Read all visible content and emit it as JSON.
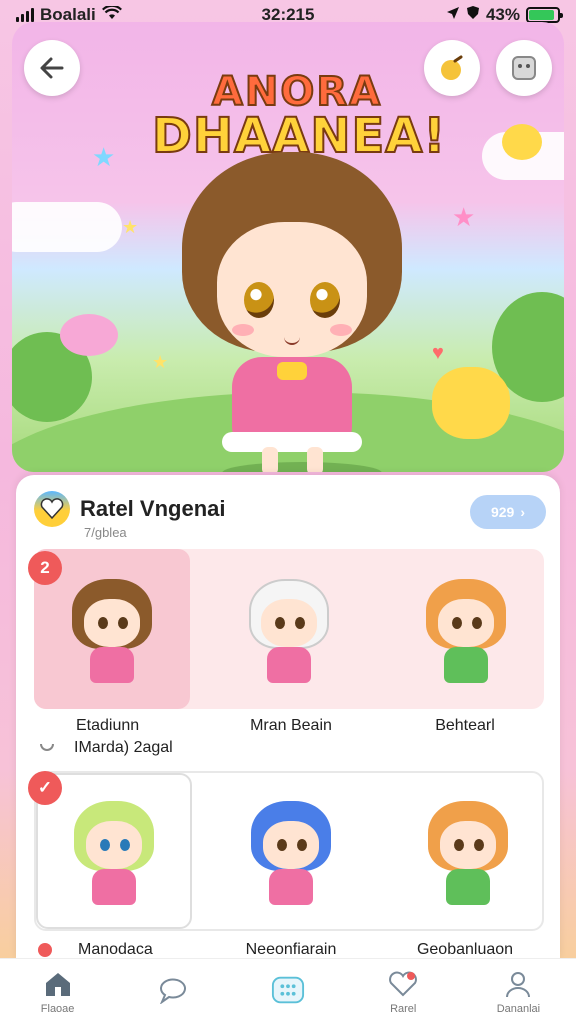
{
  "status_bar": {
    "carrier": "Boalali",
    "time": "32:215",
    "battery_percent": "43%",
    "battery_level": 0.9
  },
  "hero": {
    "back_icon": "arrow-left-icon",
    "action1_icon": "fruit-icon",
    "action2_icon": "sticker-icon",
    "logo_line1": "ANORA",
    "logo_line2": "DHAANEA!"
  },
  "panel": {
    "title": "Ratel Vngenai",
    "subtitle": "7/gblea",
    "pill_label": "929",
    "row1": {
      "badge": "2",
      "cards": [
        {
          "label": "Etadiunn",
          "hair": "#8b5a2b",
          "body": "#ef6fa3"
        },
        {
          "label": "Mran Beain",
          "hair": "#f5f5f5",
          "body": "#ef6fa3"
        },
        {
          "label": "Behtearl",
          "hair": "#f0a04a",
          "body": "#5fbf5a"
        }
      ],
      "sub_caption": "IMarda) 2agal"
    },
    "row2": {
      "badge": "✓",
      "cards": [
        {
          "label": "Manodaca",
          "hair": "#c8e87a",
          "body": "#ef6fa3"
        },
        {
          "label": "Neeonfiarain",
          "hair": "#4a7ee8",
          "body": "#ef6fa3"
        },
        {
          "label": "Geobanluaon",
          "hair": "#f0a04a",
          "body": "#5fbf5a"
        }
      ]
    }
  },
  "tabbar": {
    "tabs": [
      {
        "label": "Flaoae",
        "icon": "home-icon"
      },
      {
        "label": "",
        "icon": "chat-icon"
      },
      {
        "label": "",
        "icon": "grid-icon"
      },
      {
        "label": "Rarel",
        "icon": "heart-icon"
      },
      {
        "label": "Dananlai",
        "icon": "profile-icon"
      }
    ]
  }
}
